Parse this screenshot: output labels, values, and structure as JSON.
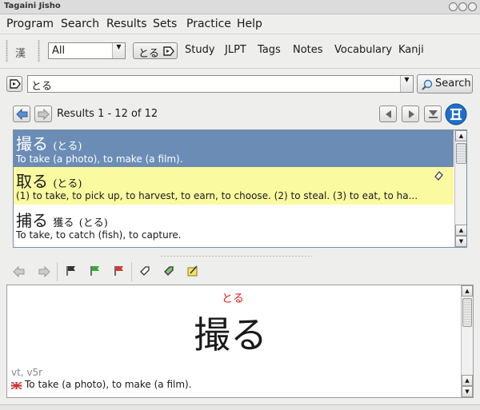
{
  "window": {
    "title": "Tagaini Jisho"
  },
  "menu": [
    {
      "label": "Program"
    },
    {
      "label": "Search"
    },
    {
      "label": "Results"
    },
    {
      "label": "Sets"
    },
    {
      "label": "Practice"
    },
    {
      "label": "Help"
    }
  ],
  "toolbar": {
    "kanji_toggle": "漢",
    "filter_value": "All",
    "active_query": "とる",
    "links": [
      "Study",
      "JLPT",
      "Tags",
      "Notes",
      "Vocabulary",
      "Kanji"
    ]
  },
  "search": {
    "value": "とる",
    "button_label": "Search"
  },
  "results": {
    "status": "Results 1 - 12 of 12",
    "entries": [
      {
        "kanji": "撮る",
        "reading": "(とる)",
        "gloss": "To take (a photo), to make (a film).",
        "selected": true
      },
      {
        "kanji": "取る",
        "reading": "(とる)",
        "gloss": "(1) to take, to pick up, to harvest, to earn, to choose. (2) to steal. (3) to eat, to ha...",
        "highlighted": true
      },
      {
        "kanji": "捕る",
        "alt": "獲る",
        "reading": "(とる)",
        "gloss": "To take, to catch (fish), to capture."
      }
    ]
  },
  "detail": {
    "reading": "とる",
    "kanji": "撮る",
    "pos": "vt, v5r",
    "gloss": "To take (a photo), to make (a film)."
  },
  "colors": {
    "selected_row": "#6b8db5",
    "highlight_row": "#fafaa0",
    "reading_red": "#e02020",
    "app_icon_blue": "#1f6fc4"
  }
}
